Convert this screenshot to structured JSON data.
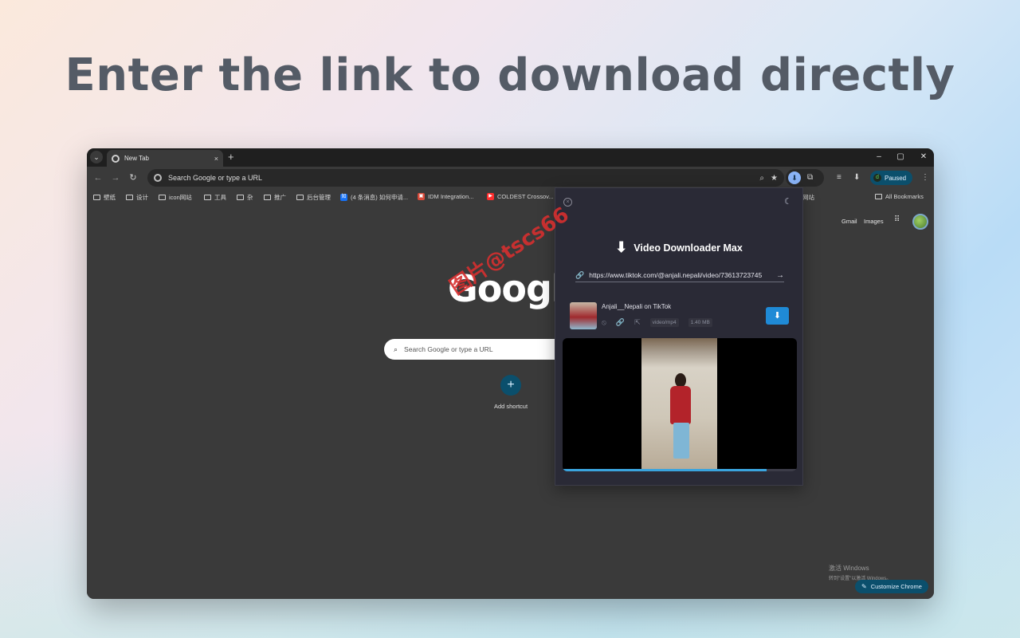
{
  "headline": "Enter the link to download directly",
  "window": {
    "tab_menu_icon": "chevron-down-icon",
    "tab_title": "New Tab",
    "tab_close": "×",
    "new_tab": "+",
    "controls": {
      "minimize": "–",
      "maximize": "▢",
      "close": "✕"
    }
  },
  "toolbar": {
    "back": "←",
    "forward": "→",
    "reload": "↻",
    "omnibox_placeholder": "Search Google or type a URL",
    "zoom_icon": "⌕",
    "star_icon": "★",
    "ext_download_icon": "⬇",
    "ext_puzzle_icon": "⧉",
    "media_icon": "≡",
    "downloads_icon": "⬇",
    "profile_status": "Paused",
    "menu_icon": "⋮"
  },
  "bookmarks": [
    {
      "label": "壁纸",
      "type": "folder"
    },
    {
      "label": "设计",
      "type": "folder"
    },
    {
      "label": "icon网站",
      "type": "folder"
    },
    {
      "label": "工具",
      "type": "folder"
    },
    {
      "label": "杂",
      "type": "folder"
    },
    {
      "label": "推广",
      "type": "folder"
    },
    {
      "label": "后台管理",
      "type": "folder"
    },
    {
      "label": "(4 条消息) 如何申请...",
      "type": "link",
      "favicon": "知",
      "color": "#1772f6"
    },
    {
      "label": "IDM Integration...",
      "type": "link",
      "favicon": "▣",
      "color": "#d84a3a"
    },
    {
      "label": "COLDEST Crossov...",
      "type": "link",
      "favicon": "▶",
      "color": "#ff2d2d"
    },
    {
      "label": "网站",
      "type": "folder"
    },
    {
      "label": "All Bookmarks",
      "type": "folder"
    }
  ],
  "newtab": {
    "gmail": "Gmail",
    "images": "Images",
    "apps_icon": "⋮⋮⋮",
    "logo": "Google",
    "search_placeholder": "Search Google or type a URL",
    "search_icon": "⌕",
    "add_shortcut_icon": "+",
    "add_shortcut_label": "Add shortcut",
    "activate_line1": "激活 Windows",
    "activate_line2": "转到\"设置\"以激活 Windows。",
    "customize_icon": "✎",
    "customize_label": "Customize Chrome"
  },
  "popup": {
    "close_icon": "×",
    "theme_icon": "☾",
    "title_icon": "⬇",
    "title": "Video Downloader Max",
    "link_icon": "🔗",
    "url_value": "https://www.tiktok.com/@anjali.nepali/video/73613723745",
    "submit_icon": "→",
    "item_title": "Anjali__Nepali on TikTok",
    "meta_icons": [
      "⦸",
      "🔗",
      "⇱"
    ],
    "format": "video/mp4",
    "size": "1.40 MB",
    "download_icon": "⬇",
    "video_progress": 0.87
  },
  "watermark": "图片@tscs66",
  "colors": {
    "headline": "#545b66",
    "chrome_dark": "#3a3a3a",
    "popup_bg": "#2a2a36",
    "accent_blue": "#1f8ad6",
    "paused_bg": "#0b4f6c"
  }
}
